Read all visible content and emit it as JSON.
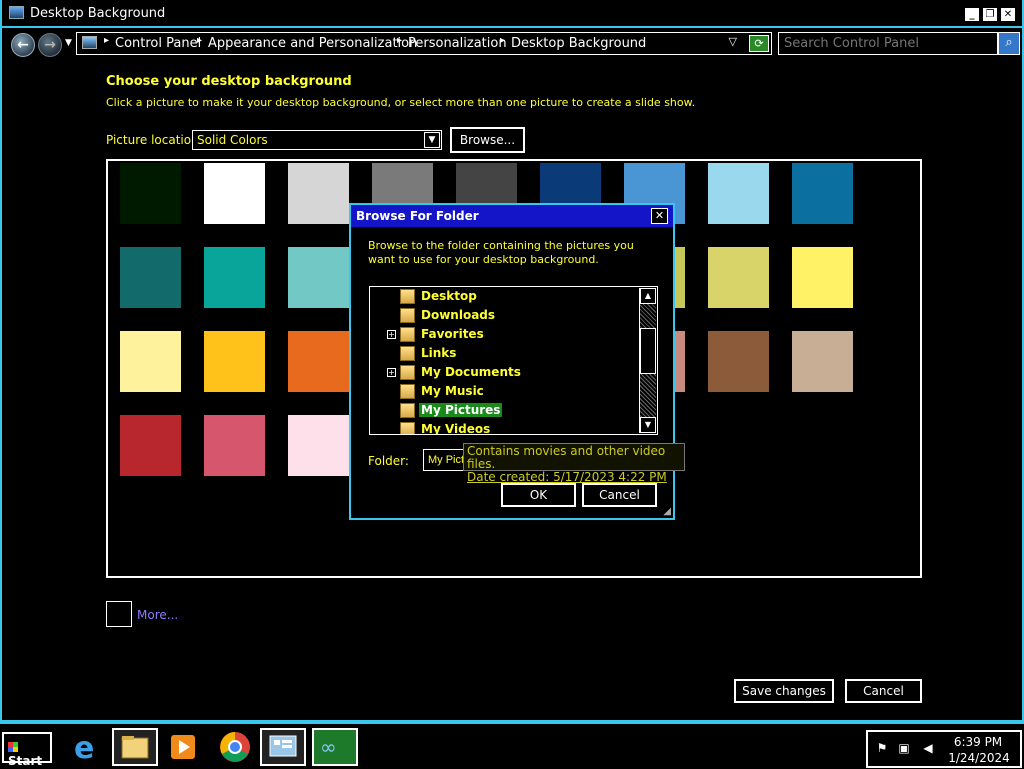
{
  "window": {
    "title": "Desktop Background",
    "controls": {
      "minimize": "_",
      "restore": "❐",
      "close": "✕"
    }
  },
  "nav": {
    "back_icon": "back-arrow-icon",
    "forward_icon": "forward-arrow-icon",
    "breadcrumbs": [
      "Control Panel",
      "Appearance and Personalization",
      "Personalization",
      "Desktop Background"
    ],
    "search_placeholder": "Search Control Panel"
  },
  "main": {
    "heading": "Choose your desktop background",
    "subtext": "Click a picture to make it your desktop background, or select more than one picture to create a slide show.",
    "location_label": "Picture location:",
    "location_value": "Solid Colors",
    "browse_label": "Browse...",
    "more_label": "More...",
    "save_label": "Save changes",
    "cancel_label": "Cancel"
  },
  "swatches": [
    "#001a00",
    "#ffffff",
    "#d6d6d6",
    "#7a7a7a",
    "#444444",
    "#0a3a78",
    "#4a95d4",
    "#9ad8ee",
    "#0b6fa0",
    "#136a6a",
    "#0aa59a",
    "#72c8c5",
    "#3aa05c",
    "#60b45a",
    "#8fbc4a",
    "#c8c85a",
    "#d9d46a",
    "#fff266",
    "#fff29c",
    "#ffc21a",
    "#e86a1f",
    "#e04a25",
    "#b83232",
    "#a05a4a",
    "#c98a80",
    "#8c5c3a",
    "#c9ae96",
    "#b8262e",
    "#d6566e",
    "#fde0ea"
  ],
  "dialog": {
    "title": "Browse For Folder",
    "description": "Browse to the folder containing the pictures you want to use for your desktop background.",
    "tree": [
      {
        "label": "Desktop",
        "expander": ""
      },
      {
        "label": "Downloads",
        "expander": ""
      },
      {
        "label": "Favorites",
        "expander": "+"
      },
      {
        "label": "Links",
        "expander": ""
      },
      {
        "label": "My Documents",
        "expander": "+"
      },
      {
        "label": "My Music",
        "expander": ""
      },
      {
        "label": "My Pictures",
        "expander": "",
        "selected": true
      },
      {
        "label": "My Videos",
        "expander": ""
      }
    ],
    "folder_label": "Folder:",
    "folder_value": "My Pictures",
    "ok_label": "OK",
    "cancel_label": "Cancel",
    "tooltip_line1": "Contains movies and other video files.",
    "tooltip_line2": "Date created: 5/17/2023 4:22 PM"
  },
  "taskbar": {
    "start_label": "Start",
    "apps": [
      "internet-explorer-icon",
      "file-explorer-icon",
      "media-player-icon",
      "chrome-icon",
      "control-panel-icon",
      "infinity-app-icon"
    ],
    "time": "6:39 PM",
    "date": "1/24/2024"
  }
}
